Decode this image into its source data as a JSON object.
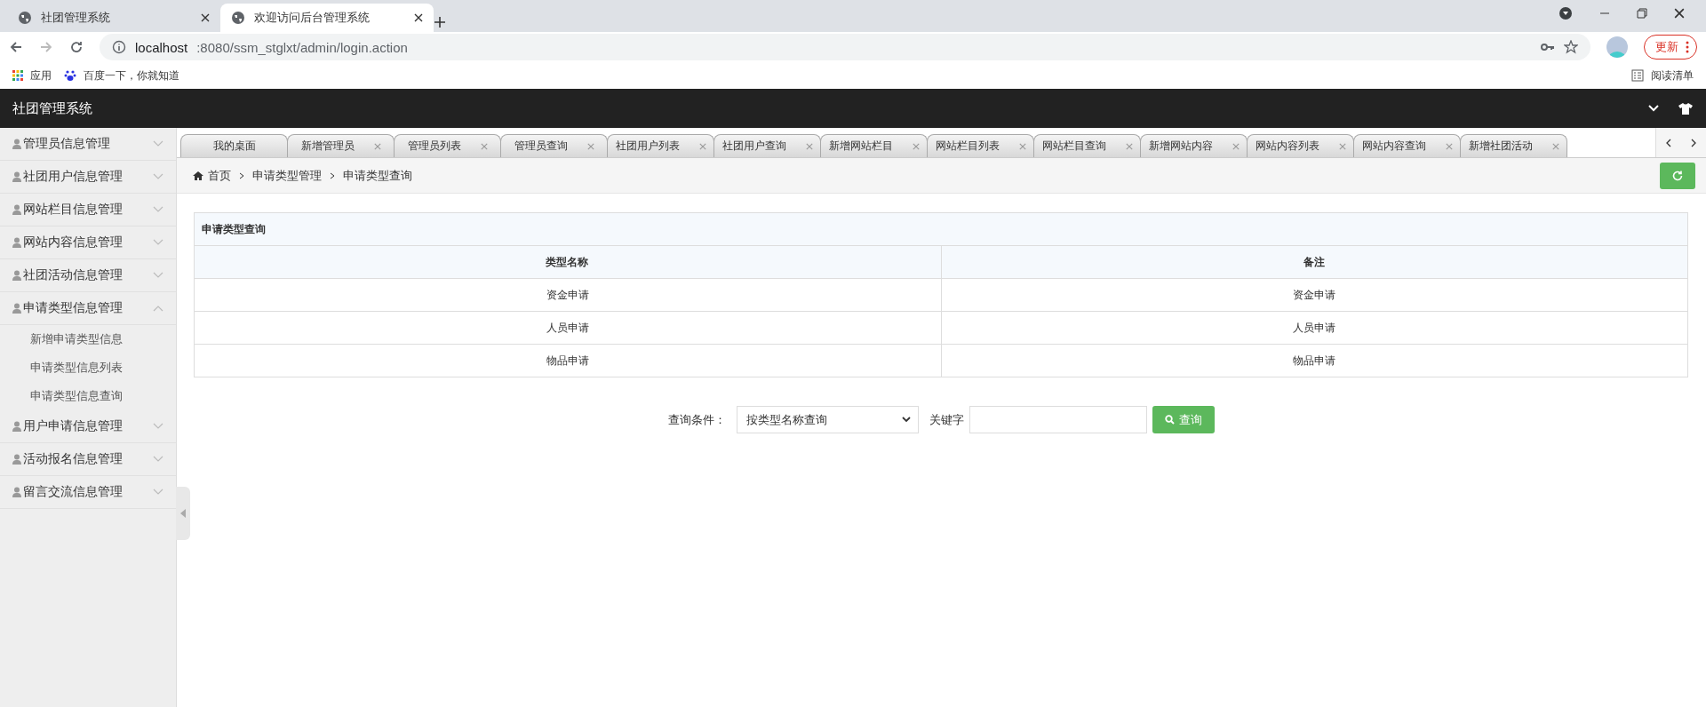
{
  "browser": {
    "tabs": [
      {
        "title": "社团管理系统",
        "selected": false
      },
      {
        "title": "欢迎访问后台管理系统",
        "selected": true
      }
    ],
    "url_host": "localhost",
    "url_rest": ":8080/ssm_stglxt/admin/login.action",
    "update_button": "更新",
    "bookmarks": [
      "应用",
      "百度一下，你就知道"
    ],
    "reading_list": "阅读清单"
  },
  "header": {
    "title": "社团管理系统"
  },
  "sidebar": {
    "items": [
      {
        "label": "管理员信息管理",
        "expanded": false
      },
      {
        "label": "社团用户信息管理",
        "expanded": false
      },
      {
        "label": "网站栏目信息管理",
        "expanded": false
      },
      {
        "label": "网站内容信息管理",
        "expanded": false
      },
      {
        "label": "社团活动信息管理",
        "expanded": false
      },
      {
        "label": "申请类型信息管理",
        "expanded": true,
        "children": [
          {
            "label": "新增申请类型信息"
          },
          {
            "label": "申请类型信息列表"
          },
          {
            "label": "申请类型信息查询"
          }
        ]
      },
      {
        "label": "用户申请信息管理",
        "expanded": false
      },
      {
        "label": "活动报名信息管理",
        "expanded": false
      },
      {
        "label": "留言交流信息管理",
        "expanded": false
      }
    ]
  },
  "page_tabs": [
    {
      "label": "我的桌面",
      "closable": false
    },
    {
      "label": "新增管理员",
      "closable": true
    },
    {
      "label": "管理员列表",
      "closable": true
    },
    {
      "label": "管理员查询",
      "closable": true
    },
    {
      "label": "社团用户列表",
      "closable": true
    },
    {
      "label": "社团用户查询",
      "closable": true
    },
    {
      "label": "新增网站栏目",
      "closable": true
    },
    {
      "label": "网站栏目列表",
      "closable": true
    },
    {
      "label": "网站栏目查询",
      "closable": true
    },
    {
      "label": "新增网站内容",
      "closable": true
    },
    {
      "label": "网站内容列表",
      "closable": true
    },
    {
      "label": "网站内容查询",
      "closable": true
    },
    {
      "label": "新增社团活动",
      "closable": true
    }
  ],
  "breadcrumb": [
    "首页",
    "申请类型管理",
    "申请类型查询"
  ],
  "table": {
    "title": "申请类型查询",
    "columns": [
      "类型名称",
      "备注"
    ],
    "rows": [
      [
        "资金申请",
        "资金申请"
      ],
      [
        "人员申请",
        "人员申请"
      ],
      [
        "物品申请",
        "物品申请"
      ]
    ]
  },
  "query": {
    "label": "查询条件：",
    "select_value": "按类型名称查询",
    "keyword_label": "关键字",
    "button": "查询"
  }
}
